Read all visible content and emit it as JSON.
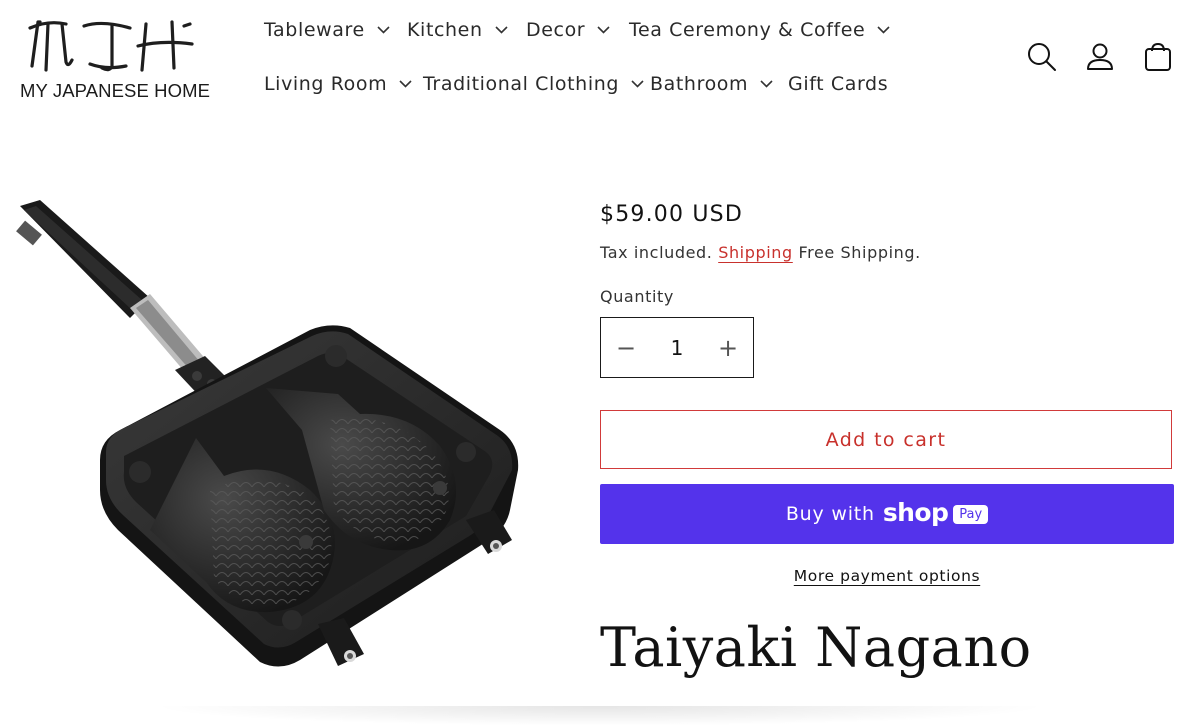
{
  "brand": {
    "logo_text": "MY JAPANESE HOME",
    "logo_icon": "mjh-brush-logo-icon"
  },
  "nav": {
    "items": [
      {
        "label": "Tableware",
        "has_dropdown": true
      },
      {
        "label": "Kitchen",
        "has_dropdown": true
      },
      {
        "label": "Decor",
        "has_dropdown": true
      },
      {
        "label": "Tea Ceremony & Coffee",
        "has_dropdown": true
      },
      {
        "label": "Living Room",
        "has_dropdown": true
      },
      {
        "label": "Traditional Clothing",
        "has_dropdown": true
      },
      {
        "label": "Bathroom",
        "has_dropdown": true
      },
      {
        "label": "Gift Cards",
        "has_dropdown": false
      }
    ]
  },
  "header_icons": [
    "search-icon",
    "account-icon",
    "cart-icon"
  ],
  "product": {
    "price": "$59.00 USD",
    "tax_prefix": "Tax included.",
    "shipping_link": "Shipping",
    "shipping_suffix": "Free Shipping.",
    "quantity_label": "Quantity",
    "quantity_value": "1",
    "qty_minus": "−",
    "qty_plus": "+",
    "add_to_cart": "Add to cart",
    "buy_with": "Buy with",
    "shop_word": "shop",
    "pay_badge": "Pay",
    "more_payment_options": "More payment options",
    "title": "Taiyaki Nagano"
  },
  "colors": {
    "accent_red": "#c8302b",
    "shop_pay_purple": "#5433eb",
    "text": "#121212"
  }
}
